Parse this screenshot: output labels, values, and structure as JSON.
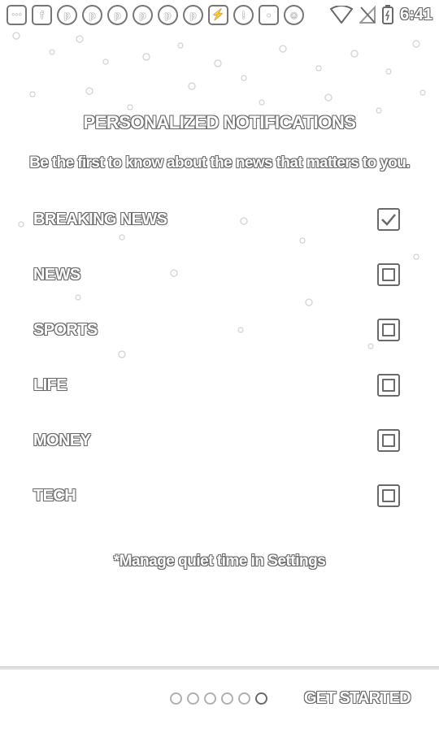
{
  "status_bar": {
    "icons": [
      "notification-icon",
      "facebook-icon",
      "pinterest-icon",
      "pinterest-icon",
      "pinterest-icon",
      "pinterest-icon",
      "pinterest-icon",
      "pinterest-icon",
      "sync-icon",
      "alarm-icon",
      "lock-icon",
      "android-icon"
    ],
    "time": "6:41"
  },
  "onboarding": {
    "title": "PERSONALIZED NOTIFICATIONS",
    "subtitle": "Be the first to know about the news that matters to you.",
    "topics": [
      {
        "label": "BREAKING NEWS",
        "checked": true
      },
      {
        "label": "NEWS",
        "checked": false
      },
      {
        "label": "SPORTS",
        "checked": false
      },
      {
        "label": "LIFE",
        "checked": false
      },
      {
        "label": "MONEY",
        "checked": false
      },
      {
        "label": "TECH",
        "checked": false
      }
    ],
    "note": "*Manage quiet time in Settings"
  },
  "footer": {
    "pages_total": 6,
    "page_active": 6,
    "get_started_label": "GET STARTED"
  }
}
